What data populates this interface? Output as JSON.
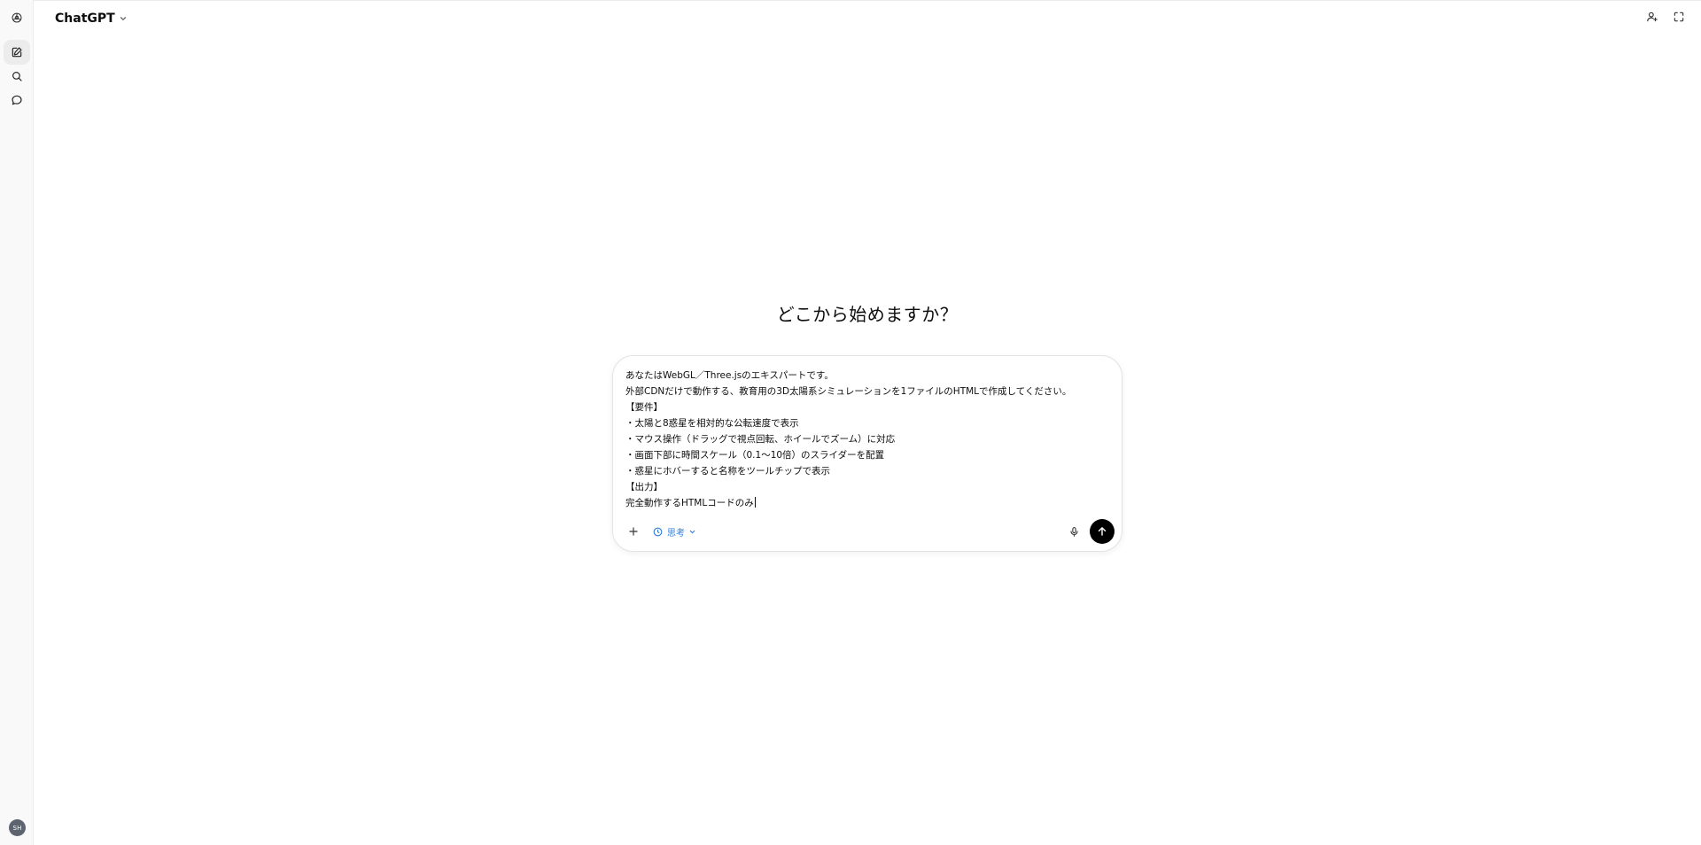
{
  "app": {
    "model_name": "ChatGPT"
  },
  "sidebar": {
    "items": [
      {
        "icon": "new-chat-icon"
      },
      {
        "icon": "search-icon"
      },
      {
        "icon": "chat-bubble-icon"
      }
    ],
    "avatar_initials": "SH"
  },
  "header": {
    "icons": [
      "add-person-icon",
      "expand-icon"
    ]
  },
  "main": {
    "headline": "どこから始めますか？"
  },
  "composer": {
    "lines": [
      "あなたはWebGL／Three.jsのエキスパートです。",
      "外部CDNだけで動作する、教育用の3D太陽系シミュレーションを1ファイルのHTMLで作成してください。",
      "【要件】",
      "・太陽と8惑星を相対的な公転速度で表示",
      "・マウス操作（ドラッグで視点回転、ホイールでズーム）に対応",
      "・画面下部に時間スケール（0.1～10倍）のスライダーを配置",
      "・惑星にホバーすると名称をツールチップで表示",
      "【出力】",
      "完全動作するHTMLコードのみ"
    ],
    "mode_label": "思考",
    "accent_color": "#2f7bd9",
    "send_button_color": "#000000"
  }
}
